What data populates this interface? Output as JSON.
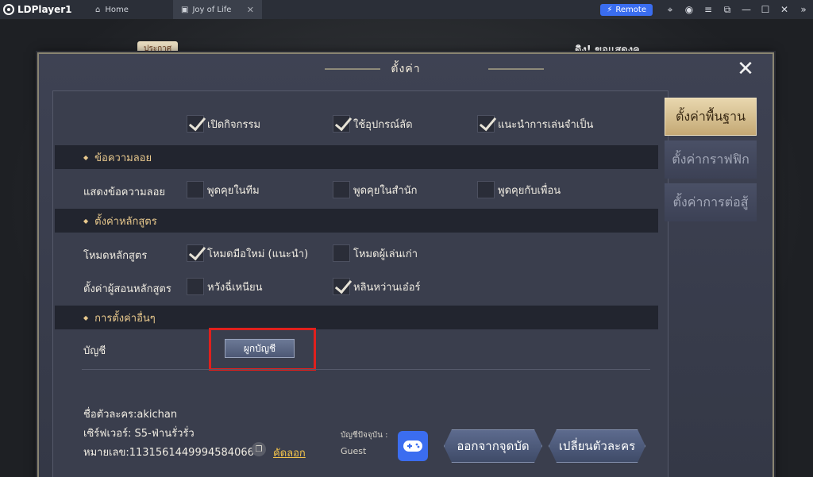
{
  "titlebar": {
    "app_name": "LDPlayer1",
    "tabs": [
      {
        "label": "Home",
        "icon": "home-icon"
      },
      {
        "label": "Joy of Life",
        "icon": "game-icon"
      }
    ],
    "remote_label": "Remote",
    "remote_color": "#3a6df0"
  },
  "game": {
    "notice_tag": "ประกาศ",
    "marquee": "ดิง! ขอแสดงค"
  },
  "dialog": {
    "title": "ตั้งค่า",
    "sidebar": [
      {
        "label": "ตั้งค่าพื้นฐาน",
        "active": true
      },
      {
        "label": "ตั้งค่ากราฟฟิก",
        "active": false
      },
      {
        "label": "ตั้งค่าการต่อสู้",
        "active": false
      }
    ],
    "top_options": [
      {
        "label": "เปิดกิจกรรม",
        "checked": true
      },
      {
        "label": "ใช้อุปกรณ์ลัด",
        "checked": true
      },
      {
        "label": "แนะนำการเล่นจำเป็น",
        "checked": true
      }
    ],
    "sections": {
      "floating_text": {
        "title": "ข้อความลอย",
        "row_label": "แสดงข้อความลอย",
        "options": [
          {
            "label": "พูดคุยในทีม",
            "checked": false
          },
          {
            "label": "พูดคุยในสำนัก",
            "checked": false
          },
          {
            "label": "พูดคุยกับเพื่อน",
            "checked": false
          }
        ]
      },
      "tutorial": {
        "title": "ตั้งค่าหลักสูตร",
        "mode_label": "โหมดหลักสูตร",
        "mode_options": [
          {
            "label": "โหมดมือใหม่ (แนะนำ)",
            "checked": true
          },
          {
            "label": "โหมดผู้เล่นเก่า",
            "checked": false
          }
        ],
        "tutor_label": "ตั้งค่าผู้สอนหลักสูตร",
        "tutor_options": [
          {
            "label": "หวังฉี่เหนียน",
            "checked": false
          },
          {
            "label": "หลินหว่านเอ๋อร์",
            "checked": true
          }
        ]
      },
      "other": {
        "title": "การตั้งค่าอื่นๆ",
        "account_label": "บัญชี",
        "bind_button": "ผูกบัญชี"
      }
    },
    "footer": {
      "character_name": "ชื่อตัวละคร:akichan",
      "server": "เซิร์ฟเวอร์:   S5-ฟ่านรั่วรั่ว",
      "id_number": "หมายเลข:1131561449994584066",
      "copy_label": "คัดลอก",
      "current_account_label": "บัญชีปัจจุบัน :",
      "current_account_value": "Guest",
      "logout_button": "ออกจากจุดบัด",
      "switch_button": "เปลี่ยนตัวละคร"
    }
  }
}
